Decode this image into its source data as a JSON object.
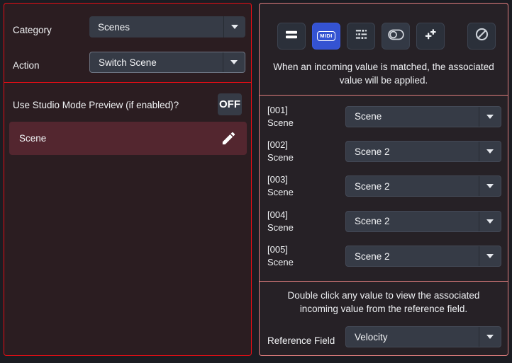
{
  "left_panel": {
    "category": {
      "label": "Category",
      "value": "Scenes"
    },
    "action": {
      "label": "Action",
      "value": "Switch Scene"
    },
    "studio_mode": {
      "label": "Use Studio Mode Preview (if enabled)?",
      "state": "OFF"
    },
    "scene_field": {
      "label": "Scene"
    }
  },
  "right_panel": {
    "toolbar": {
      "buttons": [
        "equals",
        "midi",
        "sliders",
        "toggle",
        "add-multiple",
        "ban"
      ],
      "active": "midi",
      "midi_text": "MIDI"
    },
    "info_top": "When an incoming value is matched, the associated value will be applied.",
    "rows": [
      {
        "id": "[001]",
        "type": "Scene",
        "value": "Scene"
      },
      {
        "id": "[002]",
        "type": "Scene",
        "value": "Scene 2"
      },
      {
        "id": "[003]",
        "type": "Scene",
        "value": "Scene 2"
      },
      {
        "id": "[004]",
        "type": "Scene",
        "value": "Scene 2"
      },
      {
        "id": "[005]",
        "type": "Scene",
        "value": "Scene 2"
      }
    ],
    "info_bottom": "Double click any value to view the associated incoming value from the reference field.",
    "reference": {
      "label": "Reference Field",
      "value": "Velocity"
    }
  },
  "colors": {
    "left_panel_border": "#e70d15",
    "right_panel_border": "#e07e7e",
    "midi_active_blue": "#3453d2",
    "field_highlight": "#53262f",
    "dropdown_bg": "#363b46"
  }
}
